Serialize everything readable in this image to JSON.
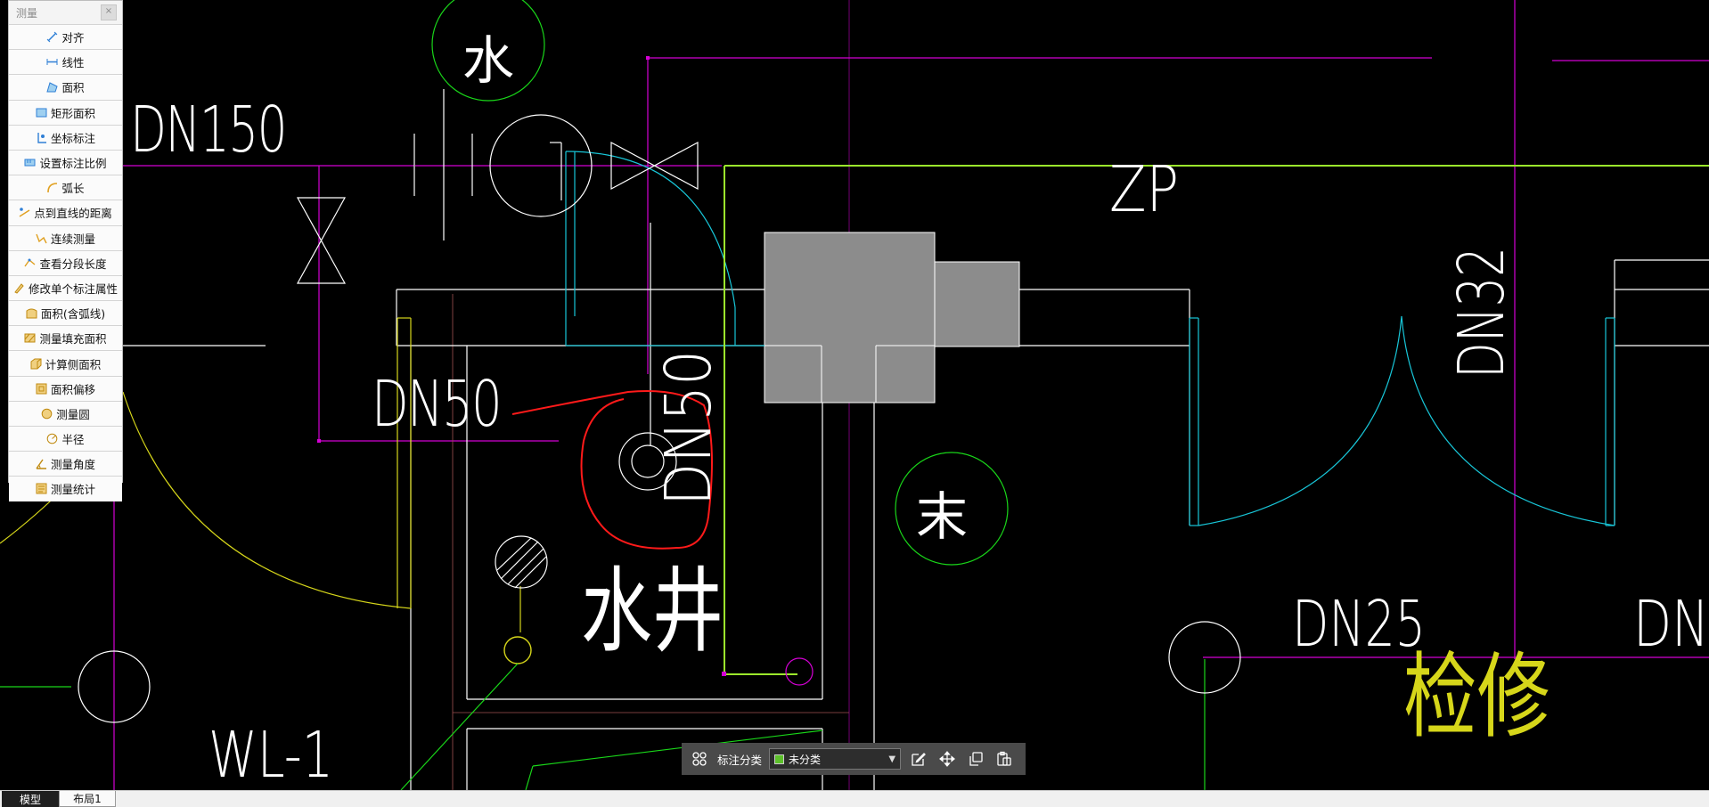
{
  "palette": {
    "title": "测量",
    "close_label": "×",
    "items": [
      {
        "label": "对齐",
        "icon": "aligned-dimension-icon"
      },
      {
        "label": "线性",
        "icon": "linear-dimension-icon"
      },
      {
        "label": "面积",
        "icon": "area-icon"
      },
      {
        "label": "矩形面积",
        "icon": "rectangle-area-icon"
      },
      {
        "label": "坐标标注",
        "icon": "coordinate-icon"
      },
      {
        "label": "设置标注比例",
        "icon": "scale-icon"
      },
      {
        "label": "弧长",
        "icon": "arc-length-icon"
      },
      {
        "label": "点到直线的距离",
        "icon": "point-line-distance-icon"
      },
      {
        "label": "连续测量",
        "icon": "continuous-measure-icon"
      },
      {
        "label": "查看分段长度",
        "icon": "segment-length-icon"
      },
      {
        "label": "修改单个标注属性",
        "icon": "edit-dimension-icon"
      },
      {
        "label": "面积(含弧线)",
        "icon": "arc-area-icon"
      },
      {
        "label": "测量填充面积",
        "icon": "hatch-area-icon"
      },
      {
        "label": "计算侧面积",
        "icon": "side-area-icon"
      },
      {
        "label": "面积偏移",
        "icon": "area-offset-icon"
      },
      {
        "label": "测量圆",
        "icon": "circle-measure-icon"
      },
      {
        "label": "半径",
        "icon": "radius-icon"
      },
      {
        "label": "测量角度",
        "icon": "angle-icon"
      },
      {
        "label": "测量统计",
        "icon": "statistics-icon"
      }
    ]
  },
  "annotation_bar": {
    "label": "标注分类",
    "selected": "未分类",
    "swatch_color": "#5cc02a"
  },
  "tabs": {
    "model": "模型",
    "layout": "布局1"
  },
  "drawing": {
    "labels": {
      "dn150": "DN150",
      "dn50_left": "DN50",
      "dn50_vertical": "DN50",
      "dn32": "DN32",
      "dn25": "DN25",
      "dn_cut": "DN",
      "zp": "ZP",
      "wl1": "WL-1",
      "shui": "水",
      "mo": "末",
      "shuijing": "水井",
      "jianxiu": "检修"
    },
    "colors": {
      "background": "#000000",
      "white": "#ffffff",
      "magenta": "#d400d4",
      "cyan": "#18c6d8",
      "green": "#19d619",
      "lime": "#9be82c",
      "yellow": "#d6d61a",
      "red": "#ff1a1a",
      "gray_fill": "#8c8c8c"
    }
  }
}
